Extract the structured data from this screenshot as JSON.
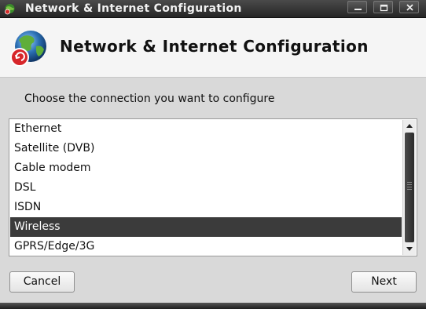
{
  "window": {
    "title": "Network & Internet Configuration",
    "controls": {
      "minimize_icon": "minimize-icon",
      "maximize_icon": "maximize-icon",
      "close_icon": "close-icon"
    }
  },
  "header": {
    "heading": "Network & Internet Configuration",
    "icon": "network-globe-icon"
  },
  "prompt": "Choose the connection you want to configure",
  "connections": {
    "items": [
      "Ethernet",
      "Satellite (DVB)",
      "Cable modem",
      "DSL",
      "ISDN",
      "Wireless",
      "GPRS/Edge/3G"
    ],
    "selected": "Wireless"
  },
  "buttons": {
    "cancel": "Cancel",
    "next": "Next"
  },
  "colors": {
    "titlebar": "#2e2e2e",
    "selection": "#3b3b3b",
    "background": "#d9d9d9"
  }
}
